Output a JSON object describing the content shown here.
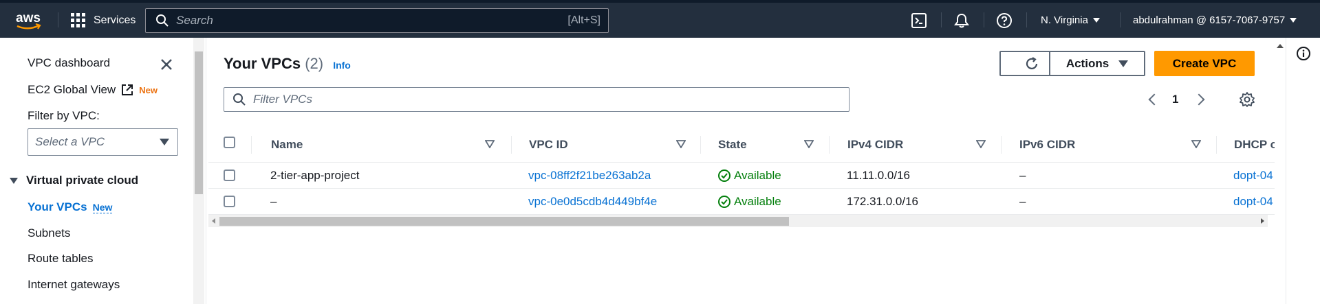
{
  "topnav": {
    "logo_text": "aws",
    "services_label": "Services",
    "search_placeholder": "Search",
    "search_shortcut": "[Alt+S]",
    "region": "N. Virginia",
    "account": "abdulrahman @ 6157-7067-9757",
    "icons": [
      "cloudshell-icon",
      "bell-icon",
      "help-icon"
    ]
  },
  "sidebar": {
    "dashboard": "VPC dashboard",
    "ec2_global": "EC2 Global View",
    "ec2_badge": "New",
    "filter_label": "Filter by VPC:",
    "select_placeholder": "Select a VPC",
    "section": "Virtual private cloud",
    "items": [
      {
        "label": "Your VPCs",
        "badge": "New",
        "active": true
      },
      {
        "label": "Subnets"
      },
      {
        "label": "Route tables"
      },
      {
        "label": "Internet gateways"
      }
    ]
  },
  "main": {
    "title": "Your VPCs",
    "count": "(2)",
    "info": "Info",
    "actions_label": "Actions",
    "create_label": "Create VPC",
    "filter_placeholder": "Filter VPCs",
    "page": "1",
    "columns": [
      "Name",
      "VPC ID",
      "State",
      "IPv4 CIDR",
      "IPv6 CIDR",
      "DHCP o"
    ],
    "rows": [
      {
        "name": "2-tier-app-project",
        "vpc_id": "vpc-08ff2f21be263ab2a",
        "state": "Available",
        "ipv4": "11.11.0.0/16",
        "ipv6": "–",
        "dhcp": "dopt-04"
      },
      {
        "name": "–",
        "vpc_id": "vpc-0e0d5cdb4d449bf4e",
        "state": "Available",
        "ipv4": "172.31.0.0/16",
        "ipv6": "–",
        "dhcp": "dopt-04"
      }
    ]
  },
  "colors": {
    "nav_bg": "#232f3e",
    "link": "#0972d3",
    "primary": "#ff9900",
    "success": "#037f0c",
    "badge_orange": "#ec7211"
  }
}
